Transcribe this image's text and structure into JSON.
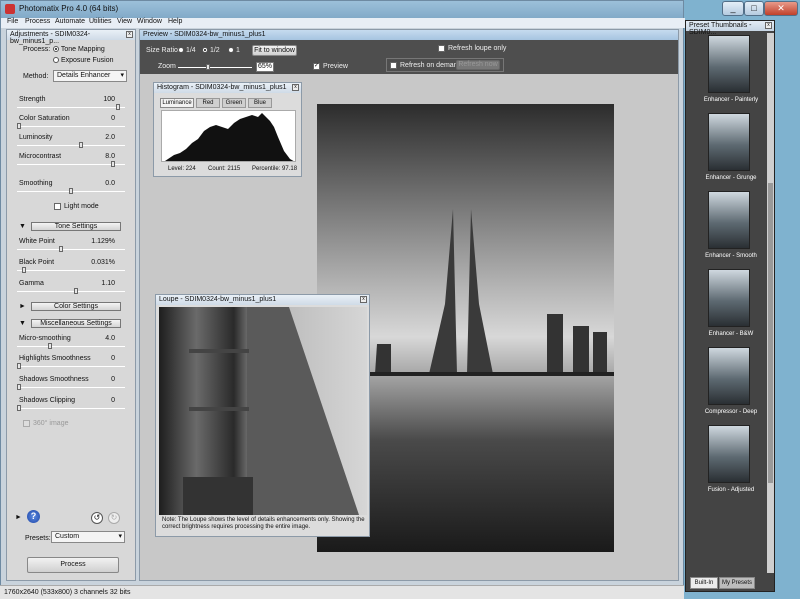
{
  "app": {
    "title": "Photomatix Pro 4.0 (64 bits)",
    "bg_color": "#7fb2cf"
  },
  "menu": [
    "File",
    "Process",
    "Automate",
    "Utilities",
    "View",
    "Window",
    "Help"
  ],
  "adjustments": {
    "title": "Adjustments - SDIM0324-bw_minus1_p...",
    "process_label": "Process:",
    "process_options": [
      "Tone Mapping",
      "Exposure Fusion"
    ],
    "process_selected": "Tone Mapping",
    "method_label": "Method:",
    "method_value": "Details Enhancer",
    "sliders": [
      {
        "label": "Strength",
        "value": "100",
        "fraction": 0.95
      },
      {
        "label": "Color Saturation",
        "value": "0",
        "fraction": 0.0
      },
      {
        "label": "Luminosity",
        "value": "2.0",
        "fraction": 0.6
      },
      {
        "label": "Microcontrast",
        "value": "8.0",
        "fraction": 0.9
      },
      {
        "label": "Smoothing",
        "value": "0.0",
        "fraction": 0.5
      }
    ],
    "light_mode_label": "Light mode",
    "tone_settings_label": "Tone Settings",
    "tone_sliders": [
      {
        "label": "White Point",
        "value": "1.129%",
        "fraction": 0.4
      },
      {
        "label": "Black Point",
        "value": "0.031%",
        "fraction": 0.05
      },
      {
        "label": "Gamma",
        "value": "1.10",
        "fraction": 0.55
      }
    ],
    "color_settings_label": "Color Settings",
    "misc_settings_label": "Miscellaneous Settings",
    "misc_sliders": [
      {
        "label": "Micro-smoothing",
        "value": "4.0",
        "fraction": 0.3
      },
      {
        "label": "Highlights Smoothness",
        "value": "0",
        "fraction": 0.0
      },
      {
        "label": "Shadows Smoothness",
        "value": "0",
        "fraction": 0.0
      },
      {
        "label": "Shadows Clipping",
        "value": "0",
        "fraction": 0.0
      }
    ],
    "image360_label": "360° image",
    "presets_label": "Presets:",
    "presets_value": "Custom",
    "process_button": "Process"
  },
  "preview": {
    "title": "Preview - SDIM0324-bw_minus1_plus1",
    "size_ratio_label": "Size Ratio:",
    "size_ratio_options": [
      "1/4",
      "1/2",
      "1"
    ],
    "size_ratio_selected": "1/2",
    "fit_button": "Fit to window",
    "zoom_label": "Zoom",
    "zoom_value": "65%",
    "zoom_fraction": 0.4,
    "preview_check_label": "Preview",
    "refresh_loupe_label": "Refresh loupe only",
    "refresh_demand_label": "Refresh on demand:",
    "refresh_now_button": "Refresh now"
  },
  "histogram": {
    "title": "Histogram - SDIM0324-bw_minus1_plus1",
    "tabs": [
      "Luminance",
      "Red",
      "Green",
      "Blue"
    ],
    "active_tab": "Luminance",
    "level": "Level: 224",
    "count": "Count: 2115",
    "percentile": "Percentile: 97.18"
  },
  "loupe": {
    "title": "Loupe - SDIM0324-bw_minus1_plus1",
    "note": "Note: The Loupe shows the level of details enhancements only. Showing the correct brightness requires processing the entire image."
  },
  "presets_panel": {
    "title": "Preset Thumbnails - SDIM0...",
    "items": [
      "Enhancer - Painterly",
      "Enhancer - Grunge",
      "Enhancer - Smooth",
      "Enhancer - B&W",
      "Compressor - Deep",
      "Fusion - Adjusted"
    ],
    "tabs": [
      "Built-In",
      "My Presets"
    ],
    "active_tab": "Built-In"
  },
  "status_bar": "1760x2640 (533x800) 3 channels 32 bits"
}
